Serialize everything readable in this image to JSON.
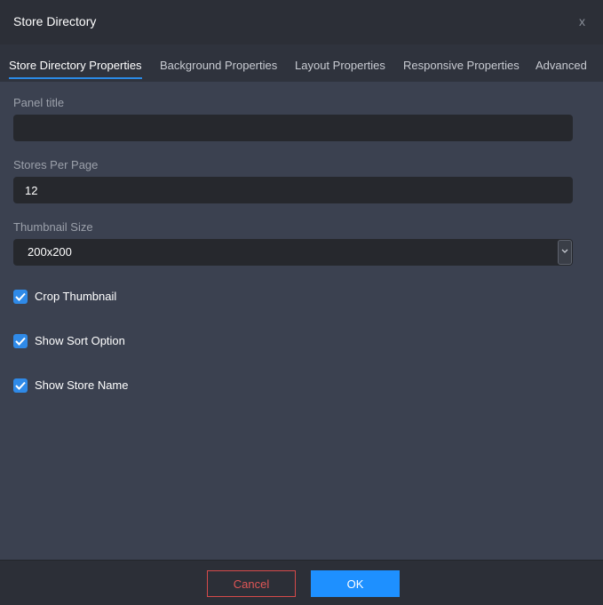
{
  "dialog": {
    "title": "Store Directory",
    "close_label": "x"
  },
  "tabs": [
    {
      "label": "Store Directory Properties",
      "active": true
    },
    {
      "label": "Background Properties",
      "active": false
    },
    {
      "label": "Layout Properties",
      "active": false
    },
    {
      "label": "Responsive Properties",
      "active": false
    },
    {
      "label": "Advanced",
      "active": false
    }
  ],
  "form": {
    "panel_title": {
      "label": "Panel title",
      "value": ""
    },
    "stores_per_page": {
      "label": "Stores Per Page",
      "value": "12"
    },
    "thumbnail_size": {
      "label": "Thumbnail Size",
      "value": "200x200"
    },
    "checkboxes": [
      {
        "label": "Crop Thumbnail",
        "checked": true
      },
      {
        "label": "Show Sort Option",
        "checked": true
      },
      {
        "label": "Show Store Name",
        "checked": true
      }
    ]
  },
  "footer": {
    "cancel_label": "Cancel",
    "ok_label": "OK"
  },
  "colors": {
    "accent": "#1e90ff",
    "cancel": "#d64a4a",
    "background": "#3b4150",
    "field": "#26282d"
  },
  "icons": [
    "close-icon",
    "chevron-down-icon",
    "checkmark-icon"
  ]
}
